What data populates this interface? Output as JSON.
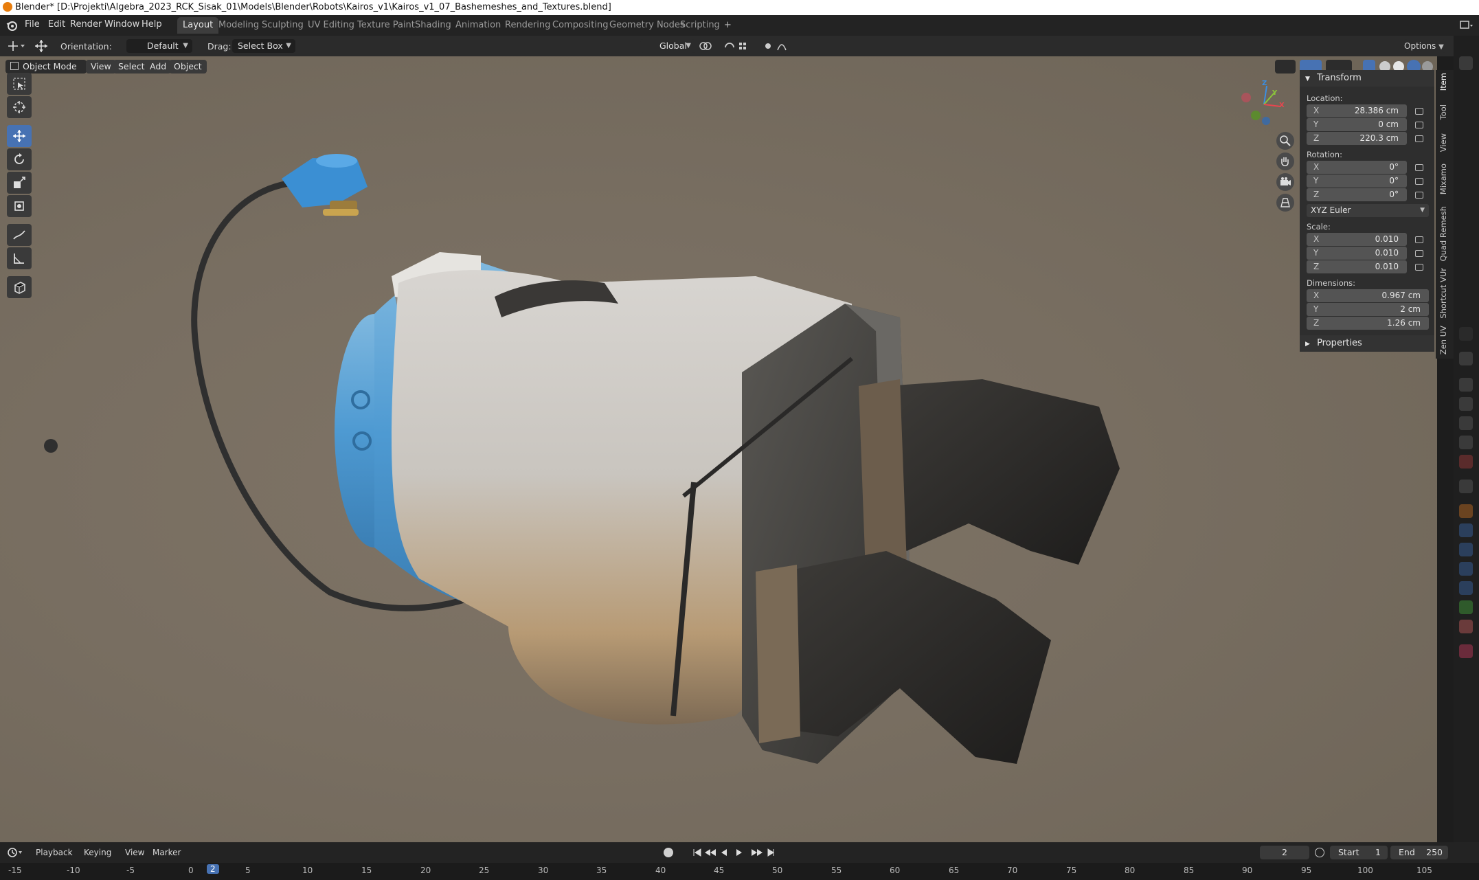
{
  "window": {
    "title": "Blender* [D:\\Projekti\\Algebra_2023_RCK_Sisak_01\\Models\\Blender\\Robots\\Kairos_v1\\Kairos_v1_07_Bashemeshes_and_Textures.blend]"
  },
  "menubar": {
    "items": [
      "File",
      "Edit",
      "Render",
      "Window",
      "Help"
    ],
    "workspaces": [
      "Layout",
      "Modeling",
      "Sculpting",
      "UV Editing",
      "Texture Paint",
      "Shading",
      "Animation",
      "Rendering",
      "Compositing",
      "Geometry Nodes",
      "Scripting"
    ],
    "add_workspace": "+"
  },
  "toolbar": {
    "orientation_label": "Orientation:",
    "orientation_value": "Default",
    "drag_label": "Drag:",
    "drag_value": "Select Box",
    "transform_orientation": "Global",
    "options": "Options"
  },
  "viewport_header": {
    "mode": "Object Mode",
    "menus": [
      "View",
      "Select",
      "Add",
      "Object"
    ]
  },
  "gizmo": {
    "x": "X",
    "y": "Y",
    "z": "Z",
    "colors": {
      "x": "#e8464f",
      "y": "#8bc43b",
      "z": "#3b8fe3"
    }
  },
  "npanel": {
    "transform_header": "Transform",
    "location_label": "Location:",
    "location": [
      {
        "axis": "X",
        "value": "28.386 cm"
      },
      {
        "axis": "Y",
        "value": "0 cm"
      },
      {
        "axis": "Z",
        "value": "220.3 cm"
      }
    ],
    "rotation_label": "Rotation:",
    "rotation": [
      {
        "axis": "X",
        "value": "0°"
      },
      {
        "axis": "Y",
        "value": "0°"
      },
      {
        "axis": "Z",
        "value": "0°"
      }
    ],
    "rotation_mode": "XYZ Euler",
    "scale_label": "Scale:",
    "scale": [
      {
        "axis": "X",
        "value": "0.010"
      },
      {
        "axis": "Y",
        "value": "0.010"
      },
      {
        "axis": "Z",
        "value": "0.010"
      }
    ],
    "dimensions_label": "Dimensions:",
    "dimensions": [
      {
        "axis": "X",
        "value": "0.967 cm"
      },
      {
        "axis": "Y",
        "value": "2 cm"
      },
      {
        "axis": "Z",
        "value": "1.26 cm"
      }
    ],
    "properties_header": "Properties"
  },
  "sidebar_tabs": [
    "Item",
    "Tool",
    "View",
    "Mixamo",
    "Quad Remesh",
    "Shortcut VUr",
    "Zen UV"
  ],
  "timeline": {
    "menus": [
      "Playback",
      "Keying",
      "View",
      "Marker"
    ],
    "current_frame": "2",
    "start_label": "Start",
    "start_value": "1",
    "end_label": "End",
    "end_value": "250",
    "ticks": [
      "-15",
      "-10",
      "-5",
      "0",
      "2",
      "5",
      "10",
      "15",
      "20",
      "25",
      "30",
      "35",
      "40",
      "45",
      "50",
      "55",
      "60",
      "65",
      "70",
      "75",
      "80",
      "85",
      "90",
      "95",
      "100",
      "105"
    ],
    "accent_color": "#4772b3"
  }
}
